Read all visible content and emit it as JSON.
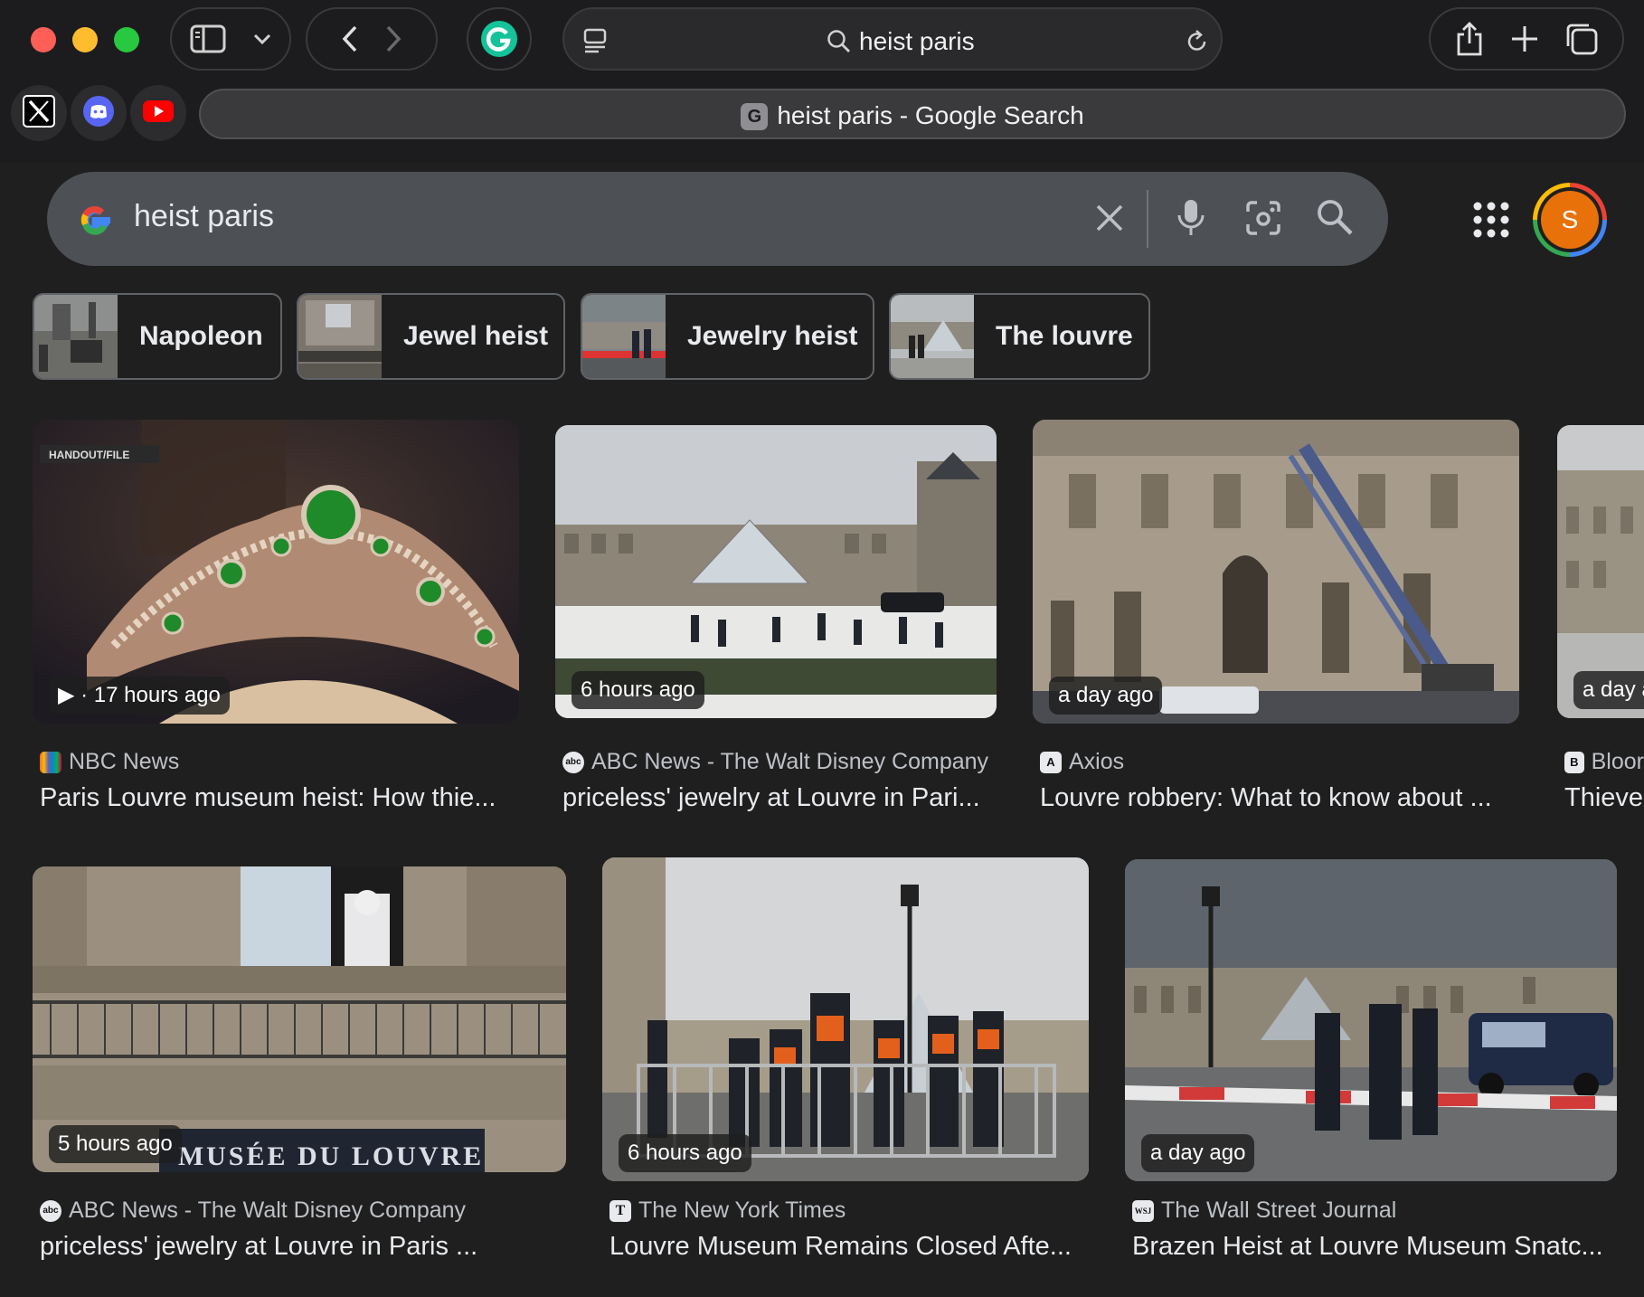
{
  "browser": {
    "address_text": "heist paris",
    "tab_title": "heist paris - Google Search",
    "tab_favicon": "G",
    "pinned_tabs": [
      {
        "icon": "x-logo-icon"
      },
      {
        "icon": "discord-icon"
      },
      {
        "icon": "youtube-icon"
      }
    ]
  },
  "search": {
    "query": "heist paris",
    "avatar_letter": "S",
    "accent": "#e8710a"
  },
  "chips": [
    {
      "label": "Napoleon"
    },
    {
      "label": "Jewel heist"
    },
    {
      "label": "Jewelry heist"
    },
    {
      "label": "The louvre"
    }
  ],
  "results": [
    {
      "badge": "▶ · 17 hours ago",
      "watermark": "HANDOUT/FILE",
      "source": "NBC News",
      "favicon": "N",
      "title": "Paris Louvre museum heist: How thie..."
    },
    {
      "badge": "6 hours ago",
      "source": "ABC News - The Walt Disney Company",
      "favicon": "abc",
      "title": "priceless' jewelry at Louvre in Pari..."
    },
    {
      "badge": "a day ago",
      "source": "Axios",
      "favicon": "A",
      "title": "Louvre robbery: What to know about ..."
    },
    {
      "badge": "a day a",
      "source": "Bloor",
      "favicon": "B",
      "title": "Thieve"
    },
    {
      "badge": "5 hours ago",
      "sign": "MUSÉE DU LOUVRE",
      "source": "ABC News - The Walt Disney Company",
      "favicon": "abc",
      "title": "priceless' jewelry at Louvre in Paris ..."
    },
    {
      "badge": "6 hours ago",
      "source": "The New York Times",
      "favicon": "T",
      "title": "Louvre Museum Remains Closed Afte..."
    },
    {
      "badge": "a day ago",
      "source": "The Wall Street Journal",
      "favicon": "WSJ",
      "title": "Brazen Heist at Louvre Museum Snatc..."
    }
  ]
}
